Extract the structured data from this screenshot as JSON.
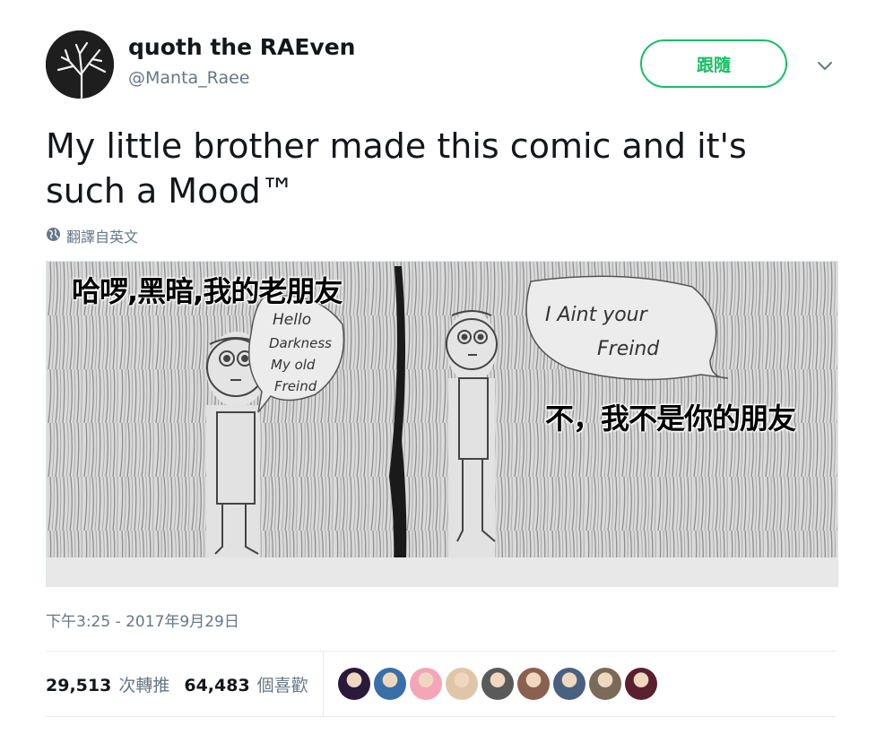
{
  "user": {
    "display_name": "quoth the RAEven",
    "username": "@Manta_Raee",
    "avatar_icon": "tree-silhouette-avatar"
  },
  "follow_button": {
    "label": "跟隨"
  },
  "caret_icon": "chevron-down-icon",
  "tweet": {
    "text": "My little brother made this comic and it's such a Mood™"
  },
  "translate": {
    "label": "翻譯自英文",
    "icon": "globe-icon"
  },
  "media": {
    "overlay_top": "哈啰,黑暗,我的老朋友",
    "overlay_bottom": "不，我不是你的朋友",
    "bubble_left": [
      "Hello",
      "Darkness",
      "My old",
      "Freind"
    ],
    "bubble_right": [
      "I Aint your",
      "Freind"
    ]
  },
  "timestamp": "下午3:25 - 2017年9月29日",
  "stats": {
    "retweets_count": "29,513",
    "retweets_label": "次轉推",
    "likes_count": "64,483",
    "likes_label": "個喜歡"
  },
  "likers": [
    {
      "name": "liker-avatar-1",
      "color": "#2a1a3a"
    },
    {
      "name": "liker-avatar-2",
      "color": "#3a6ea8"
    },
    {
      "name": "liker-avatar-3",
      "color": "#f4a6b8"
    },
    {
      "name": "liker-avatar-4",
      "color": "#e0c6a8"
    },
    {
      "name": "liker-avatar-5",
      "color": "#5a5a5a"
    },
    {
      "name": "liker-avatar-6",
      "color": "#8a6050"
    },
    {
      "name": "liker-avatar-7",
      "color": "#4a6080"
    },
    {
      "name": "liker-avatar-8",
      "color": "#7a6a5a"
    },
    {
      "name": "liker-avatar-9",
      "color": "#5a2030"
    }
  ],
  "colors": {
    "accent_green": "#17bf63",
    "muted_text": "#657786",
    "primary_text": "#14171a"
  }
}
